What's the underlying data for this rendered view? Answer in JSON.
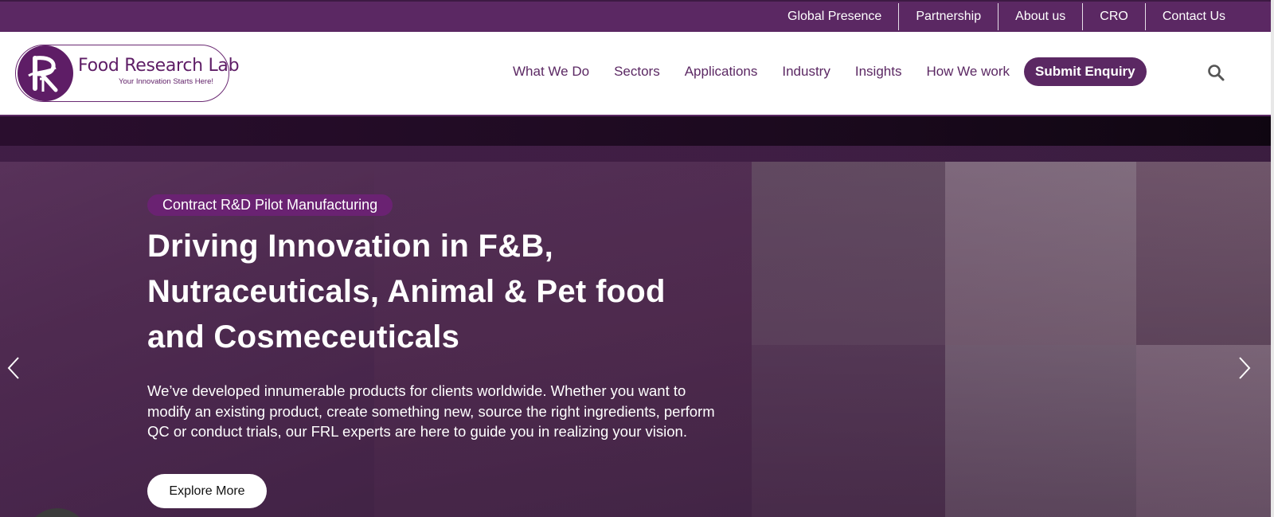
{
  "topbar": {
    "links": [
      "Global Presence",
      "Partnership",
      "About us",
      "CRO",
      "Contact Us"
    ]
  },
  "logo": {
    "title": "Food Research Lab",
    "tagline": "Your Innovation Starts Here!"
  },
  "nav": {
    "items": [
      "What We Do",
      "Sectors",
      "Applications",
      "Industry",
      "Insights",
      "How We work"
    ],
    "cta": "Submit Enquiry",
    "search_icon": "search-icon"
  },
  "hero": {
    "badge": "Contract R&D Pilot Manufacturing",
    "headline": "Driving Innovation in F&B, Nutraceuticals, Animal & Pet food and Cosmeceuticals",
    "description": "We’ve developed innumerable products for clients worldwide. Whether you want to modify an existing product, create something new, source the right ingredients, perform QC or conduct trials, our FRL experts are here to guide you in realizing your vision.",
    "button": "Explore More"
  },
  "colors": {
    "brand_purple": "#5b2863",
    "badge_purple": "#6a2272",
    "white": "#ffffff"
  }
}
